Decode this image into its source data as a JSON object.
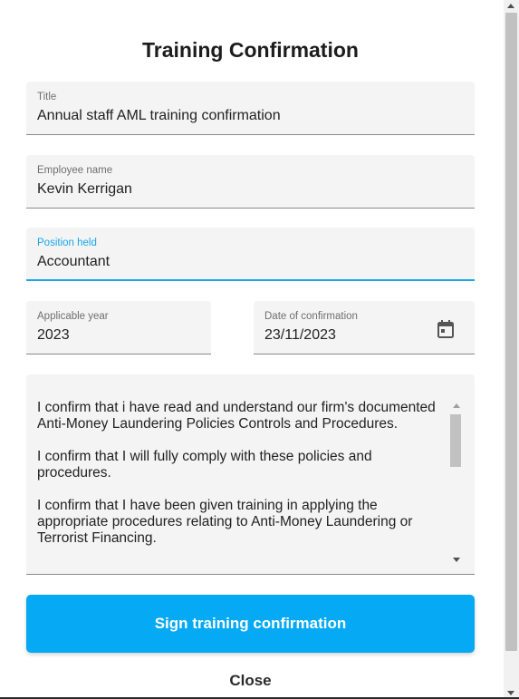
{
  "dialog": {
    "title": "Training Confirmation"
  },
  "fields": {
    "title": {
      "label": "Title",
      "value": "Annual staff AML training confirmation"
    },
    "employee_name": {
      "label": "Employee name",
      "value": "Kevin Kerrigan"
    },
    "position_held": {
      "label": "Position held",
      "value": "Accountant"
    },
    "applicable_year": {
      "label": "Applicable year",
      "value": "2023"
    },
    "date_of_confirmation": {
      "label": "Date of confirmation",
      "value": "23/11/2023",
      "icon": "calendar-icon"
    }
  },
  "statement": {
    "paragraphs": [
      "I confirm that i have read and understand our firm's documented Anti-Money Laundering Policies Controls and Procedures.",
      "I confirm that I will fully comply with these policies and procedures.",
      "I confirm that I have been given training in applying the appropriate procedures relating to Anti-Money Laundering or Terrorist Financing."
    ]
  },
  "actions": {
    "sign_label": "Sign training confirmation",
    "close_label": "Close"
  },
  "colors": {
    "primary": "#05a9f4",
    "focus": "#18a6e8",
    "field_bg": "#f4f4f4"
  }
}
